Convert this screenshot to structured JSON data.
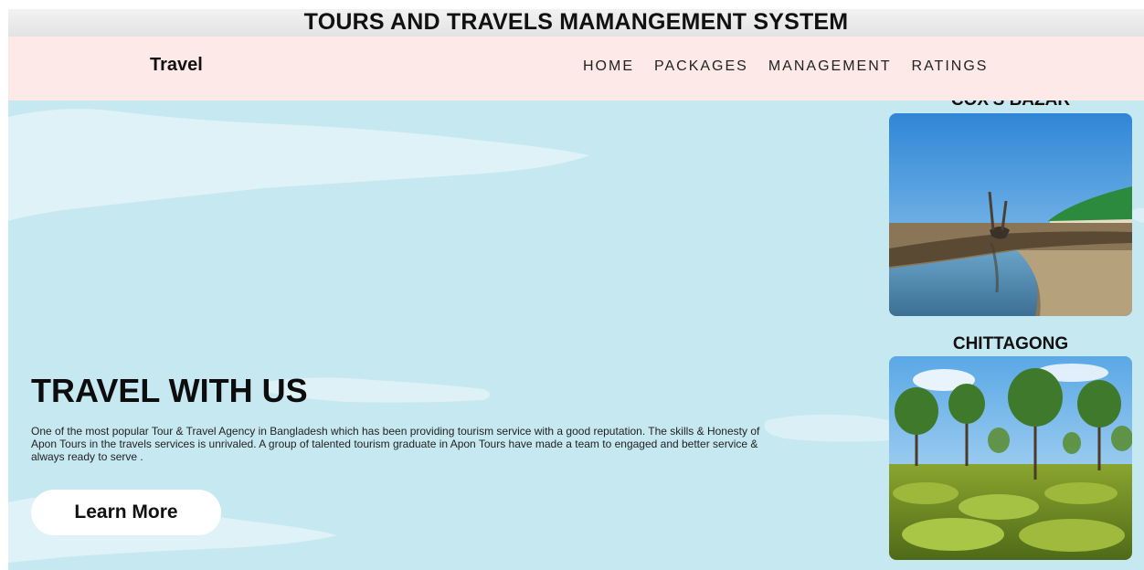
{
  "header": {
    "title": "TOURS AND TRAVELS MAMANGEMENT SYSTEM"
  },
  "nav": {
    "brand": "Travel",
    "links": [
      "HOME",
      "PACKAGES",
      "MANAGEMENT",
      "RATINGS"
    ]
  },
  "hero": {
    "title": "TRAVEL WITH US",
    "description": "One of the most popular Tour & Travel Agency in Bangladesh which has been providing tourism service with a good reputation. The skills & Honesty of Apon Tours in the travels services is unrivaled. A group of talented tourism graduate in Apon Tours have made a team to engaged and better service & always ready to serve .",
    "button_label": "Learn More"
  },
  "destinations": [
    {
      "name": "COX'S BAZAR"
    },
    {
      "name": "CHITTAGONG"
    }
  ],
  "colors": {
    "hero_background": "#c6e8f1",
    "navbar_background": "#fde9e8",
    "title_bar_background": "#e8e8e8"
  }
}
